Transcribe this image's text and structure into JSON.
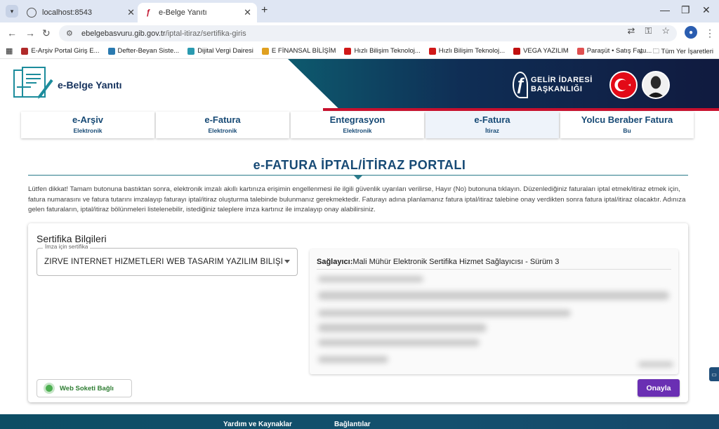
{
  "browser": {
    "tabs": [
      {
        "title": "localhost:8543"
      },
      {
        "title": "e-Belge Yanıtı"
      }
    ],
    "url_host": "ebelgebasvuru.gib.gov.tr",
    "url_path": "/iptal-itiraz/sertifika-giris",
    "bookmarks": [
      {
        "label": "E-Arşiv Portal Giriş E...",
        "color": "#b02a2a"
      },
      {
        "label": "Defter-Beyan Siste...",
        "color": "#2a7ab0"
      },
      {
        "label": "Dijital Vergi Dairesi",
        "color": "#2a9ab0"
      },
      {
        "label": "E FİNANSAL BİLİŞİM",
        "color": "#e0a020"
      },
      {
        "label": "Hızlı Bilişim Teknoloj...",
        "color": "#d01818"
      },
      {
        "label": "Hızlı Bilişim Teknoloj...",
        "color": "#d01818"
      },
      {
        "label": "VEGA YAZILIM",
        "color": "#c01010"
      },
      {
        "label": "Paraşüt • Satış Fatu...",
        "color": "#e05050"
      }
    ],
    "bookmarks_overflow": "»",
    "all_bookmarks": "Tüm Yer İşaretleri"
  },
  "header": {
    "logo_text": "e-Belge Yanıtı",
    "gib_line1": "GELİR İDARESİ",
    "gib_line2": "BAŞKANLIĞI"
  },
  "menu": [
    {
      "title": "e-Arşiv",
      "sub": "Elektronik"
    },
    {
      "title": "e-Fatura",
      "sub": "Elektronik"
    },
    {
      "title": "Entegrasyon",
      "sub": "Elektronik"
    },
    {
      "title": "e-Fatura",
      "sub": "İtiraz"
    },
    {
      "title": "Yolcu Beraber Fatura",
      "sub": "Bu"
    }
  ],
  "page": {
    "title": "e-FATURA İPTAL/İTİRAZ PORTALI",
    "notice": "Lütfen dikkat! Tamam butonuna bastıktan sonra, elektronik imzalı akıllı kartınıza erişimin engellenmesi ile ilgili güvenlik uyarıları verilirse, Hayır (No) butonuna tıklayın. Düzenlediğiniz faturaları iptal etmek/itiraz etmek için, fatura numarasını ve fatura tutarını imzalayıp faturayı iptal/itiraz oluşturma talebinde bulunmanız gerekmektedir. Faturayı adına planlamanız fatura iptal/itiraz talebine onay verdikten sonra fatura iptal/itiraz olacaktır. Adınıza gelen faturaların, iptal/itiraz bölünmeleri listelenebilir, istediğiniz taleplere imza kartınız ile imzalayıp onay alabilirsiniz."
  },
  "certificate": {
    "section_title": "Sertifika Bilgileri",
    "select_legend": "İmza için sertifika",
    "select_value": "ZİRVE İNTERNET HİZMETLERİ WEB TASARIM YAZILIM BİLİŞİ...",
    "provider_label": "Sağlayıcı:",
    "provider_value": "Mali Mühür Elektronik Sertifika Hizmet Sağlayıcısı - Sürüm 3",
    "websocket_status": "Web Soketi Bağlı",
    "approve_label": "Onayla"
  },
  "footer": {
    "col1": "Yardım ve Kaynaklar",
    "col2": "Bağlantılar"
  }
}
